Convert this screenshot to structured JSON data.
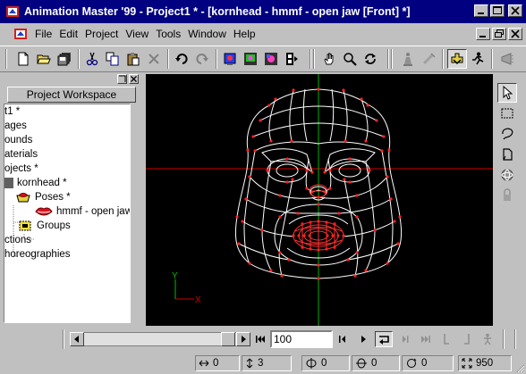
{
  "window": {
    "title": "Animation Master '99 - Project1 * - [kornhead - hmmf - open jaw [Front] *]"
  },
  "menu": [
    "File",
    "Edit",
    "Project",
    "View",
    "Tools",
    "Window",
    "Help"
  ],
  "toolbar": {
    "icons": [
      "new-icon",
      "open-icon",
      "save-all-icon",
      "cut-icon",
      "copy-icon",
      "paste-icon",
      "delete-icon",
      "undo-icon",
      "redo-icon",
      "render-icon",
      "render-to-file-icon",
      "render-lock-icon",
      "filmstrip-icon",
      "hand-icon",
      "zoom-icon",
      "turn-icon",
      "bones-icon",
      "muscle-icon",
      "skeletal-mode-icon",
      "animate-mode-icon",
      "choreography-icon"
    ]
  },
  "workspace": {
    "header": "Project Workspace",
    "tree": [
      {
        "label": "t1 *"
      },
      {
        "label": "ages"
      },
      {
        "label": "ounds"
      },
      {
        "label": "aterials"
      },
      {
        "label": "ojects *"
      },
      {
        "label": "kornhead *"
      },
      {
        "label": "Poses *"
      },
      {
        "label": "hmmf - open jaw *"
      },
      {
        "label": "Groups"
      },
      {
        "label": "ctions"
      },
      {
        "label": "horeographies"
      }
    ]
  },
  "viewport": {
    "axis_y_label": "Y",
    "axis_x_label": "X"
  },
  "right_tools": [
    "select-arrow-icon",
    "group-select-icon",
    "lasso-icon",
    "bounding-box-icon",
    "sphere-icon",
    "lock-icon"
  ],
  "timeline": {
    "frame": "100"
  },
  "status": {
    "cell1": "0",
    "cell2": "3",
    "cell3": "0",
    "cell4": "0",
    "cell5": "0",
    "cell6": "950"
  },
  "colors": {
    "title_bg": "#000080",
    "face_wire": "#ffffff",
    "cp_dots": "#ff2020",
    "crosshair_v": "#00b000",
    "crosshair_h": "#d00000"
  }
}
